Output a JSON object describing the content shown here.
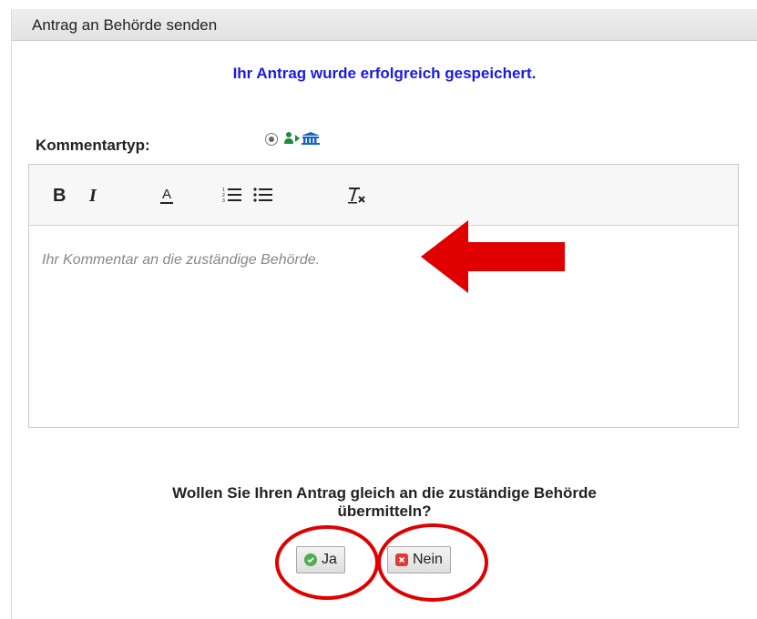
{
  "dialog": {
    "title": "Antrag an Behörde senden",
    "success_message": "Ihr Antrag wurde erfolgreich gespeichert.",
    "comment_type_label": "Kommentartyp:",
    "comment_type_icon": "citizen-to-authority-icon"
  },
  "editor": {
    "toolbar": [
      {
        "name": "bold",
        "label": "B"
      },
      {
        "name": "italic",
        "label": "I"
      },
      {
        "name": "text-color",
        "label": "A"
      },
      {
        "name": "numbered-list",
        "label": "numbered-list-icon"
      },
      {
        "name": "bulleted-list",
        "label": "bulleted-list-icon"
      },
      {
        "name": "clear-format",
        "label": "Tx"
      }
    ],
    "placeholder": "Ihr Kommentar an die zuständige Behörde."
  },
  "question": {
    "line1": "Wollen Sie Ihren Antrag gleich an die zuständige Behörde",
    "line2": "übermitteln?"
  },
  "buttons": {
    "yes_label": "Ja",
    "no_label": "Nein"
  },
  "colors": {
    "success_text": "#1a1ae6",
    "annotation_red": "#e00000",
    "yes_icon": "#4caf50",
    "no_icon": "#e53935"
  }
}
